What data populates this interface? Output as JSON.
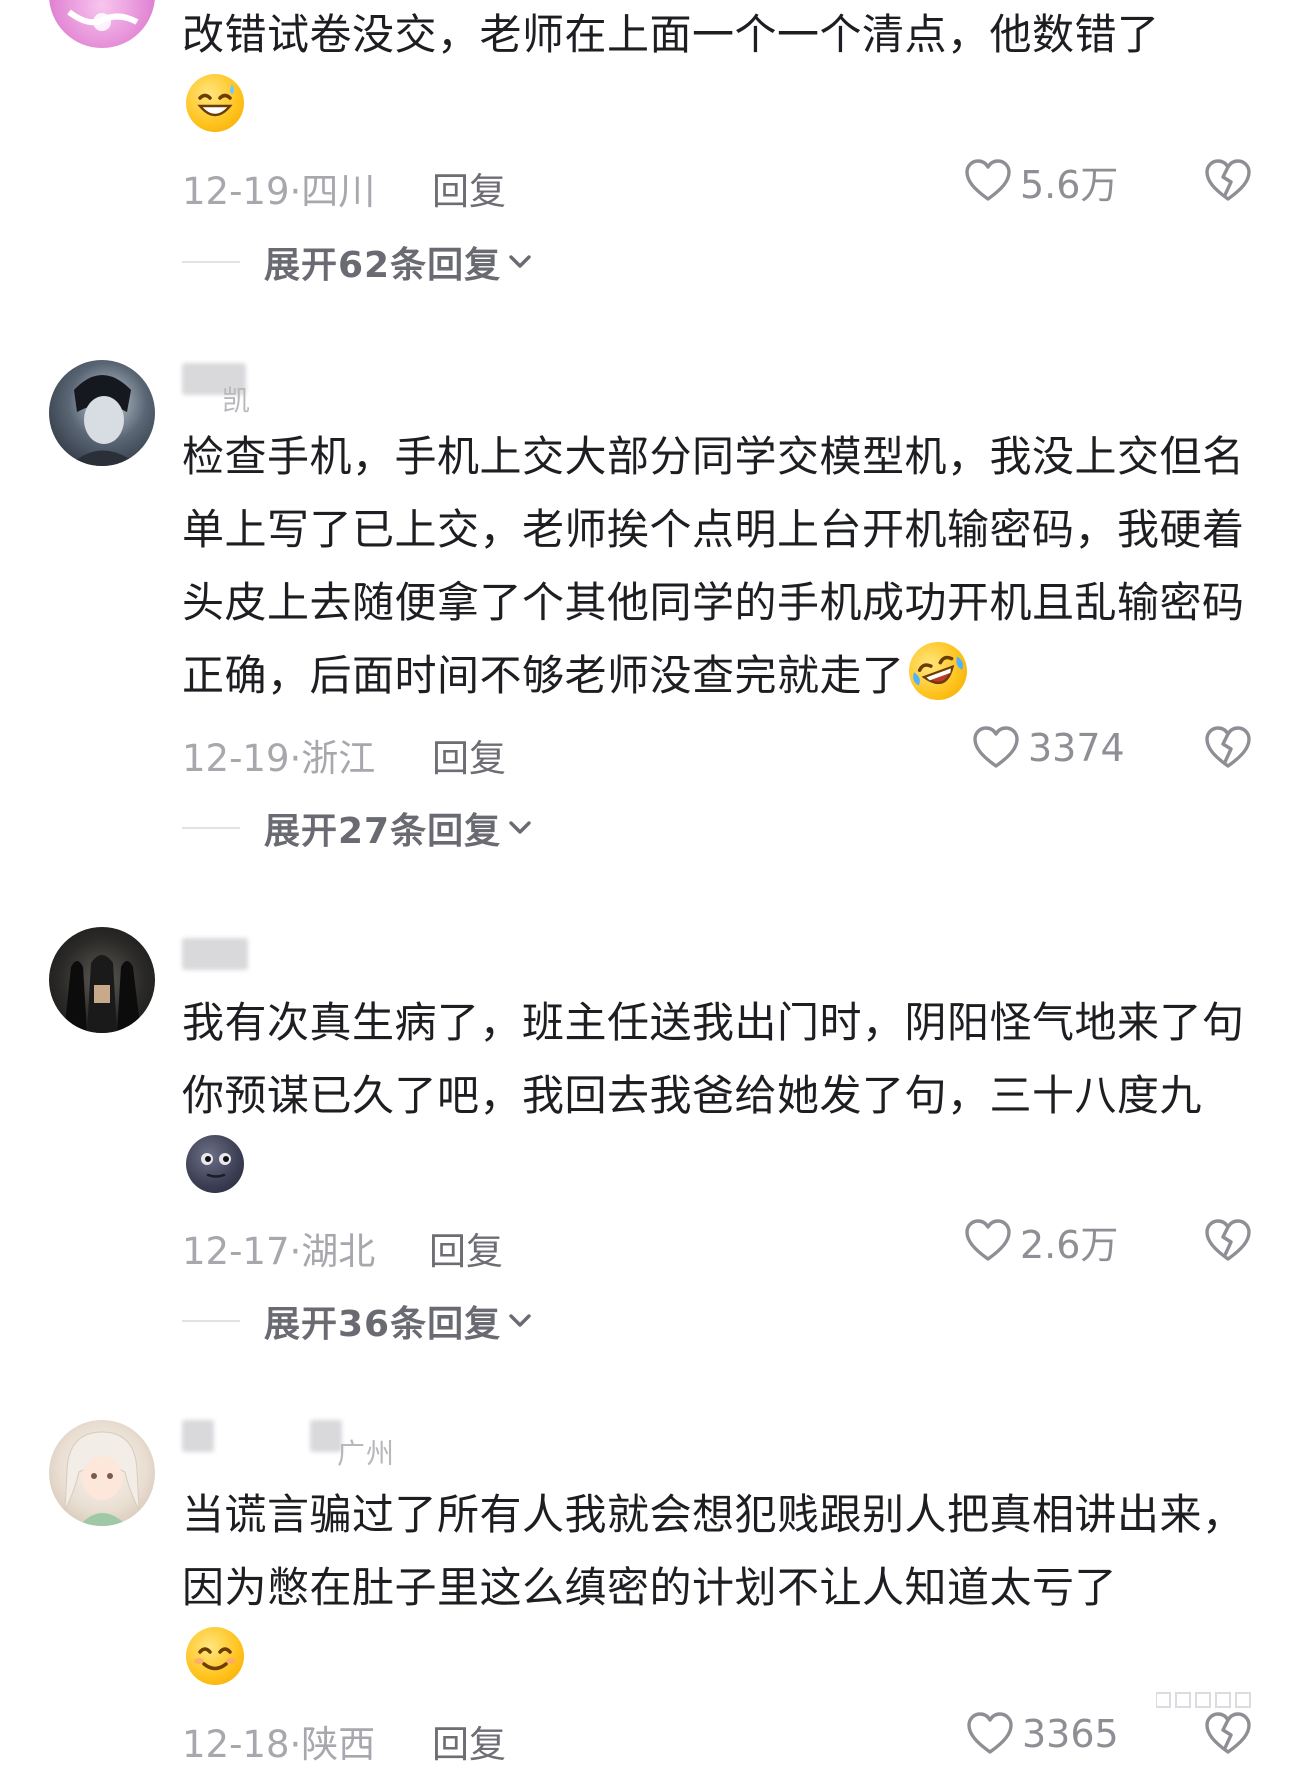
{
  "comments": [
    {
      "text": "改错试卷没交，老师在上面一个一个清点，他数错了",
      "emoji": "grinning-sweat-emoji",
      "date_location": "12-19·四川",
      "reply_label": "回复",
      "likes": "5.6万",
      "expand_label": "展开62条回复"
    },
    {
      "username_fragment": "凯",
      "text": "检查手机，手机上交大部分同学交模型机，我没上交但名单上写了已上交，老师挨个点明上台开机输密码，我硬着头皮上去随便拿了个其他同学的手机成功开机且乱输密码正确，后面时间不够老师没查完就走了",
      "emoji": "rolling-laughing-emoji",
      "date_location": "12-19·浙江",
      "reply_label": "回复",
      "likes": "3374",
      "expand_label": "展开27条回复"
    },
    {
      "text": "我有次真生病了，班主任送我出门时，阴阳怪气地来了句你预谋已久了吧，我回去我爸给她发了句，三十八度九",
      "emoji": "new-moon-face-emoji",
      "date_location": "12-17·湖北",
      "reply_label": "回复",
      "likes": "2.6万",
      "expand_label": "展开36条回复"
    },
    {
      "username_fragment": "广州",
      "text": "当谎言骗过了所有人我就会想犯贱跟别人把真相讲出来，因为憋在肚子里这么缜密的计划不让人知道太亏了",
      "emoji": "smiling-face-emoji",
      "date_location": "12-18·陕西",
      "reply_label": "回复",
      "likes": "3365"
    }
  ],
  "colors": {
    "text": "#1d1d22",
    "meta": "#a7a7ad",
    "reply": "#6d6d74",
    "icon": "#8e8e95"
  }
}
